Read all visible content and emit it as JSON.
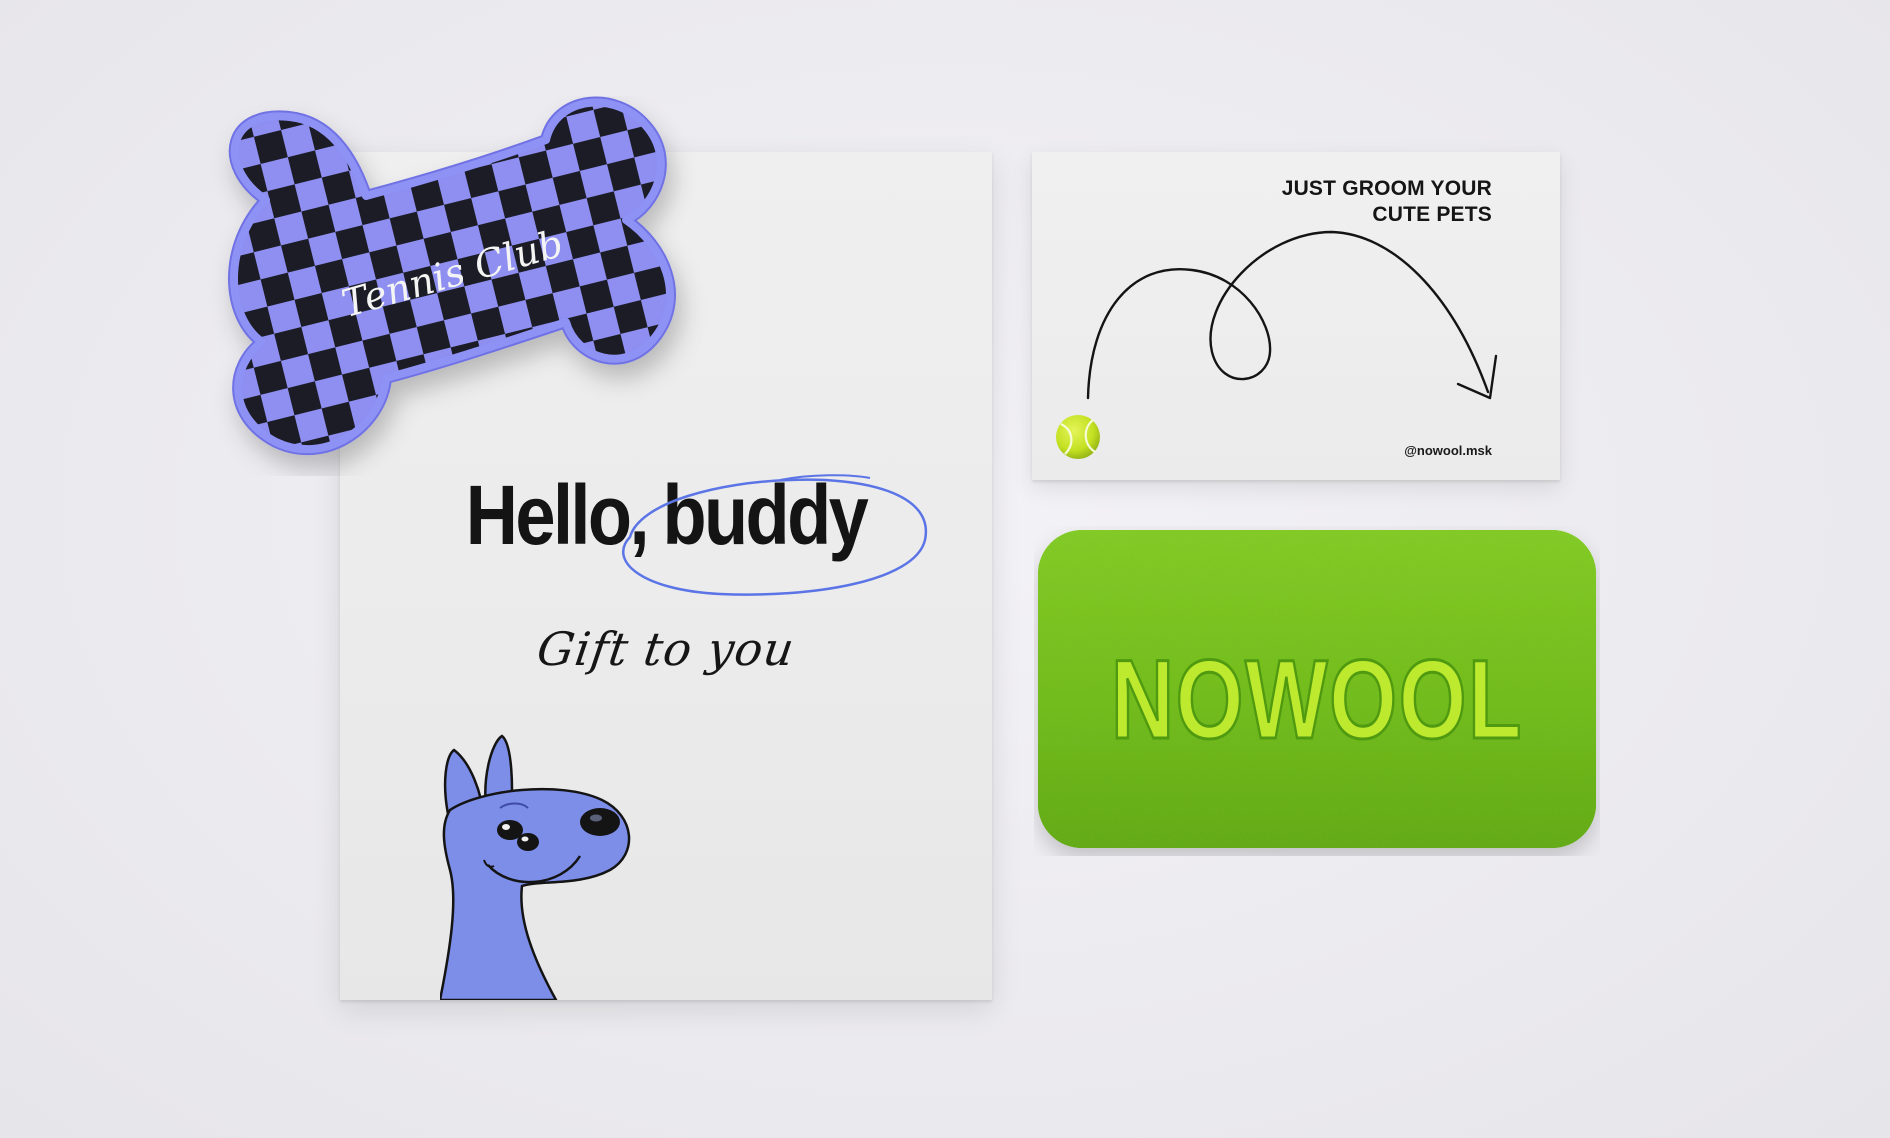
{
  "poster": {
    "headline_word_1": "Hello,",
    "headline_word_2": "buddy",
    "script_line": "Gift to you"
  },
  "business_card": {
    "tagline_line_1": "JUST GROOM YOUR",
    "tagline_line_2": "CUTE PETS",
    "handle": "@nowool.msk"
  },
  "bone_toy": {
    "label": "Tennis Club"
  },
  "grass_mat": {
    "logo": "NOWOOL"
  },
  "colors": {
    "background": "#ecebef",
    "paper": "#ededed",
    "ink": "#141414",
    "accent_blue": "#5b74e6",
    "dog_violet": "#7d8ee8",
    "bone_violet": "#8e8ff0",
    "grass_green": "#6fbf1c",
    "tennis_ball": "#c9e52a"
  }
}
